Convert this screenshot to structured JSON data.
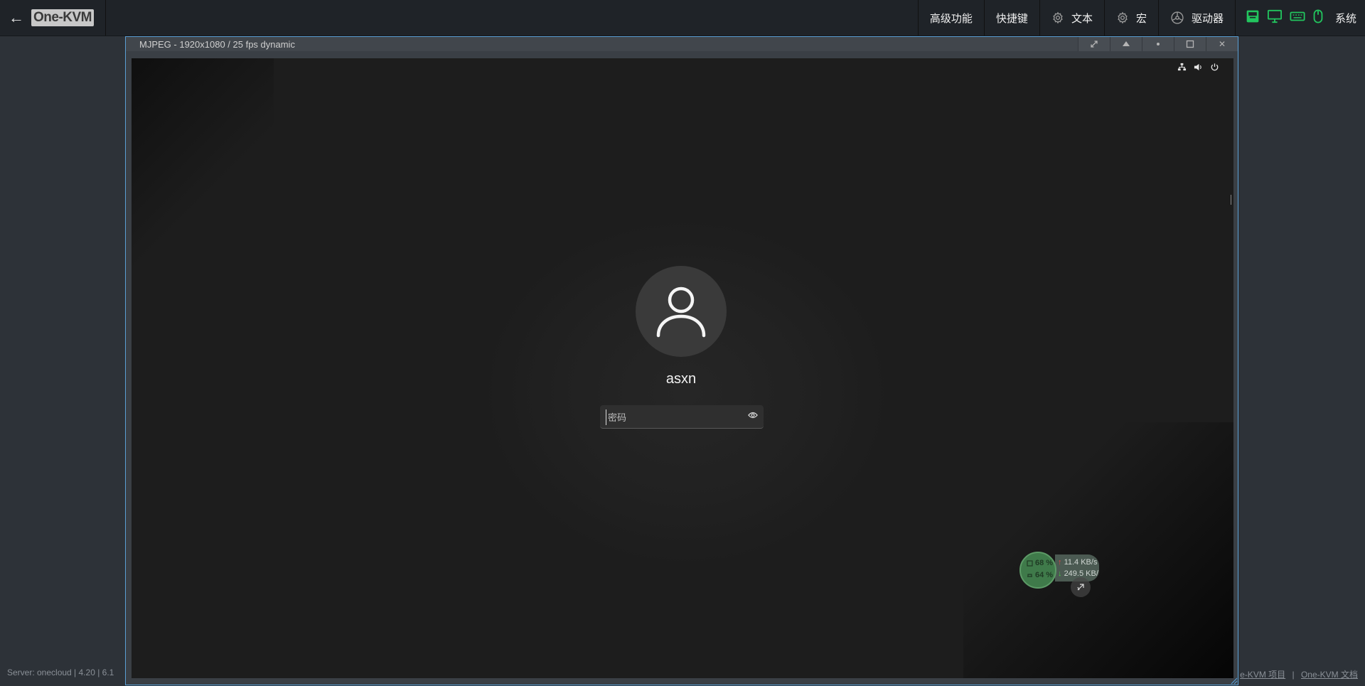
{
  "app": {
    "back_symbol": "←",
    "logo_text": "One-KVM"
  },
  "nav": {
    "advanced": "高级功能",
    "shortcuts": "快捷键",
    "text": "文本",
    "macro": "宏",
    "drive": "驱动器",
    "system": "系统"
  },
  "status_icons": [
    "ethernet-icon",
    "monitor-icon",
    "keyboard-icon",
    "mouse-icon"
  ],
  "stream": {
    "title": "MJPEG - 1920x1080 / 25 fps dynamic",
    "controls": [
      "expand-icon",
      "eject-icon",
      "dot-icon",
      "maximize-icon",
      "close-icon"
    ],
    "close_glyph": "✕"
  },
  "login": {
    "username": "asxn",
    "password_placeholder": "密码",
    "tray_icons": [
      "network-icon",
      "volume-icon",
      "power-icon"
    ]
  },
  "perf": {
    "cpu": "68 %",
    "mem": "64 %",
    "upload": "11.4 KB/s",
    "download": "249.5 KB/",
    "up_arrow": "↑",
    "down_arrow": "↓",
    "cpu_color": "#3f7a4a"
  },
  "footer": {
    "server": "Server: onecloud  |  4.20  |  6.1",
    "project_link": "e-KVM 项目",
    "separator": "|",
    "docs_link": "One-KVM 文档"
  },
  "colors": {
    "accent_green": "#22c55e",
    "window_border": "#5a9fd4"
  }
}
